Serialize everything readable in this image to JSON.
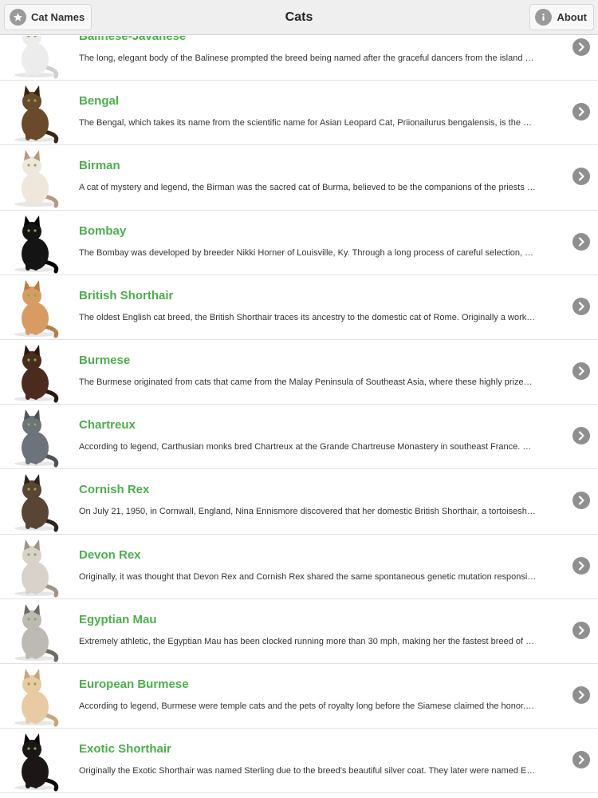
{
  "navbar": {
    "title": "Cats",
    "left_button": {
      "label": "Cat Names",
      "icon": "star-icon"
    },
    "right_button": {
      "label": "About",
      "icon": "info-icon"
    }
  },
  "colors": {
    "title_green": "#4caf4c",
    "chevron_gray": "#8f8f8f",
    "navbar_bg": "#efefef"
  },
  "breeds": [
    {
      "name": "Balinese-Javanese",
      "description": "The long, elegant body of the Balinese prompted the breed being named after the graceful dancers from the island …",
      "coat": "#ececec",
      "accent": "#cfcfcf"
    },
    {
      "name": "Bengal",
      "description": "The Bengal, which takes its name from the scientific name for Asian Leopard Cat, Priionailurus bengalensis, is the …",
      "coat": "#6b4a2b",
      "accent": "#3a2513"
    },
    {
      "name": "Birman",
      "description": "A cat of mystery and legend, the Birman was the sacred cat of Burma, believed to be the companions of the priests …",
      "coat": "#efe7dc",
      "accent": "#b59a80"
    },
    {
      "name": "Bombay",
      "description": "The Bombay was developed by breeder Nikki Horner of Louisville, Ky. Through a long process of careful selection, …",
      "coat": "#141414",
      "accent": "#000000"
    },
    {
      "name": "British Shorthair",
      "description": "The oldest English cat breed, the British Shorthair traces its ancestry to the domestic cat of Rome. Originally a work…",
      "coat": "#d89c62",
      "accent": "#b77d45"
    },
    {
      "name": "Burmese",
      "description": "The Burmese originated from cats that came from the Malay Peninsula of Southeast Asia, where these highly prize…",
      "coat": "#4a2b1e",
      "accent": "#2c1810"
    },
    {
      "name": "Chartreux",
      "description": "According to legend, Carthusian monks bred Chartreux at the Grande Chartreuse Monastery in southeast France. …",
      "coat": "#6d737a",
      "accent": "#4e5358"
    },
    {
      "name": "Cornish Rex",
      "description": "On July 21, 1950, in Cornwall, England, Nina Ennismore discovered that her domestic British Shorthair, a tortoisesh…",
      "coat": "#5a4434",
      "accent": "#2e2219"
    },
    {
      "name": "Devon Rex",
      "description": "Originally, it was thought that Devon Rex and Cornish Rex shared the same spontaneous genetic mutation responsi…",
      "coat": "#d8d2cb",
      "accent": "#a09486"
    },
    {
      "name": "Egyptian Mau",
      "description": "Extremely athletic, the Egyptian Mau has been clocked running more than 30 mph, making her the fastest breed of …",
      "coat": "#bdbab4",
      "accent": "#6f6a62"
    },
    {
      "name": "European Burmese",
      "description": "According to legend, Burmese were temple cats and the pets of royalty long before the Siamese claimed the honor.…",
      "coat": "#e9cba3",
      "accent": "#c9a57a"
    },
    {
      "name": "Exotic Shorthair",
      "description": "Originally the Exotic Shorthair was named Sterling due to the breed's beautiful silver coat. They later were named E…",
      "coat": "#1c1716",
      "accent": "#0b0908"
    }
  ]
}
